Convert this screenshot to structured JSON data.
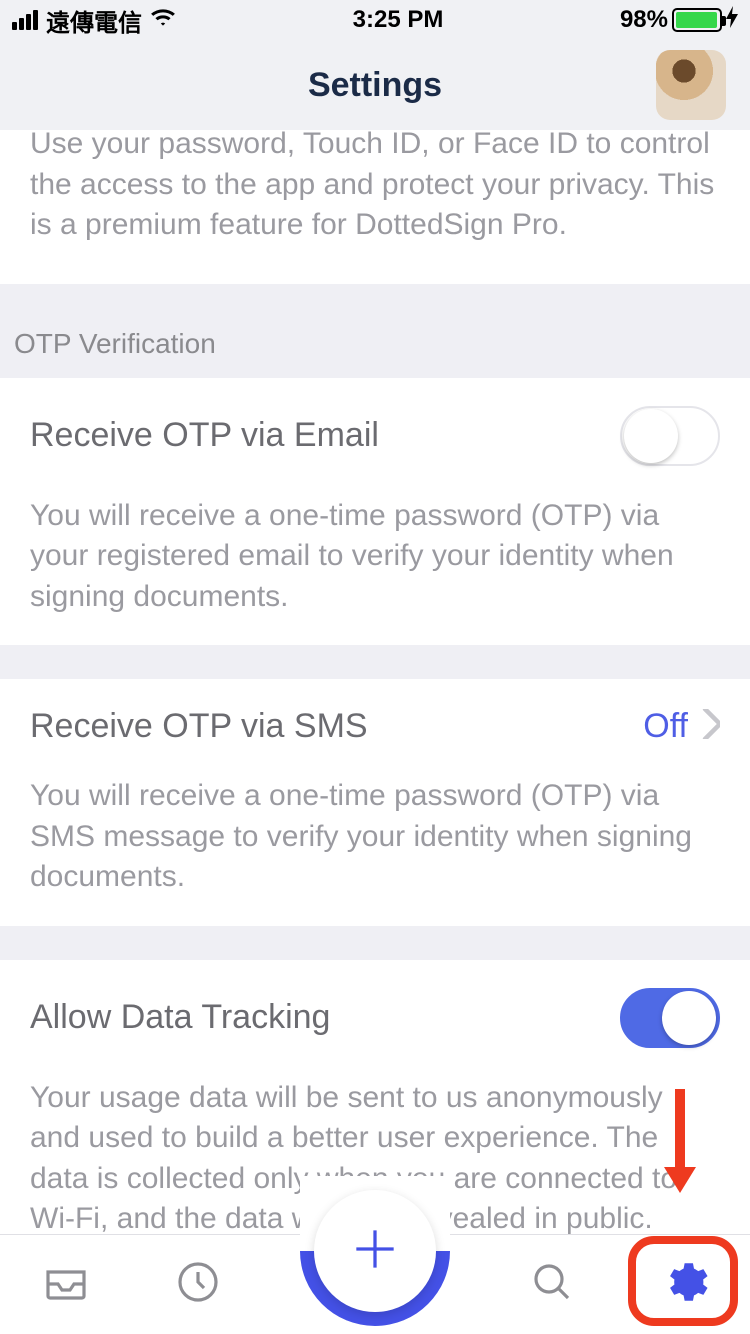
{
  "status_bar": {
    "carrier": "遠傳電信",
    "time": "3:25 PM",
    "battery_pct": "98%"
  },
  "header": {
    "title": "Settings"
  },
  "top_desc": "Use your password, Touch ID, or Face ID to control the access to the app and protect your privacy. This is a premium feature for DottedSign Pro.",
  "otp_section_header": "OTP Verification",
  "otp_email": {
    "title": "Receive OTP via Email",
    "desc": "You will receive a one-time password (OTP) via your registered email to verify your identity when signing documents.",
    "enabled": false
  },
  "otp_sms": {
    "title": "Receive OTP via SMS",
    "value": "Off",
    "desc": "You will receive a one-time password (OTP) via SMS message to verify your identity when signing documents."
  },
  "data_tracking": {
    "title": "Allow Data Tracking",
    "desc": "Your usage data will be sent to us anonymously and used to build a better user experience. The data is collected only when you are connected to Wi-Fi, and the data won't be revealed in public.",
    "enabled": true
  }
}
